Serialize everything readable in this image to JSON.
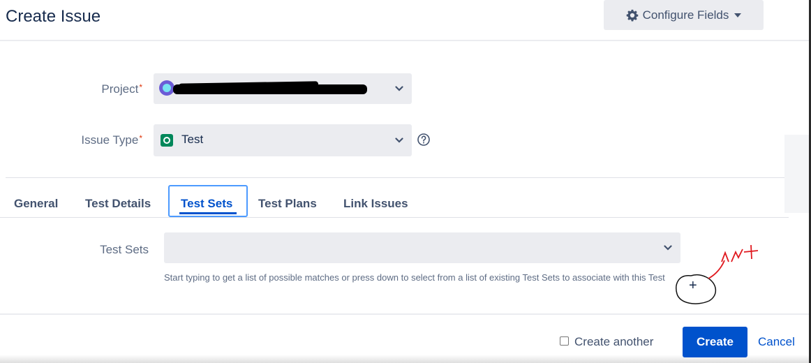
{
  "dialog": {
    "title": "Create Issue",
    "configure_label": "Configure Fields",
    "configure_icon": "gear-icon",
    "accent": "#0052cc"
  },
  "fields": {
    "project": {
      "label": "Project",
      "required_mark": "*"
    },
    "issue_type": {
      "label": "Issue Type",
      "required_mark": "*",
      "value": "Test"
    }
  },
  "tabs": [
    {
      "label": "General"
    },
    {
      "label": "Test Details"
    },
    {
      "label": "Test Sets",
      "active": true
    },
    {
      "label": "Test Plans"
    },
    {
      "label": "Link Issues"
    }
  ],
  "test_sets": {
    "label": "Test Sets",
    "value": "",
    "help": "Start typing to get a list of possible matches or press down to select from a list of existing Test Sets to associate with this Test"
  },
  "annotation": {
    "plus": "+"
  },
  "footer": {
    "create_another_label": "Create another",
    "create_another_checked": false,
    "create_label": "Create",
    "cancel_label": "Cancel"
  }
}
